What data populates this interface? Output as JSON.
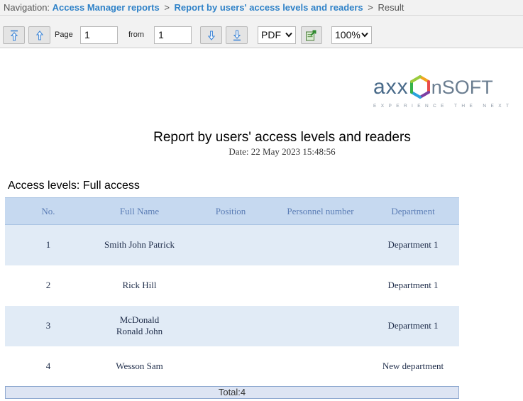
{
  "navigation": {
    "prefix": "Navigation:",
    "crumbs": [
      "Access Manager reports",
      "Report by users' access levels and readers"
    ],
    "current": "Result",
    "separator": ">"
  },
  "toolbar": {
    "page_label": "Page",
    "page_value": "1",
    "from_label": "from",
    "from_value": "1",
    "format": "PDF",
    "zoom": "100%"
  },
  "logo": {
    "word_left": "axx",
    "word_right": "nSOFT",
    "tagline": "EXPERIENCE THE NEXT",
    "colors": [
      "#f2a51f",
      "#e84a4a",
      "#7c3fa3",
      "#2aa3dc",
      "#35b24a"
    ]
  },
  "report": {
    "title": "Report by users' access levels and readers",
    "date": "Date: 22 May 2023 15:48:56",
    "section": "Access levels: Full access",
    "columns": [
      "No.",
      "Full Name",
      "Position",
      "Personnel number",
      "Department"
    ],
    "rows": [
      {
        "no": "1",
        "name": "Smith John Patrick",
        "position": "",
        "personnel": "",
        "department": "Department 1"
      },
      {
        "no": "2",
        "name": "Rick Hill",
        "position": "",
        "personnel": "",
        "department": "Department 1"
      },
      {
        "no": "3",
        "name": "McDonald Ronald John",
        "position": "",
        "personnel": "",
        "department": "Department 1"
      },
      {
        "no": "4",
        "name": "Wesson Sam",
        "position": "",
        "personnel": "",
        "department": "New department"
      }
    ],
    "total": "Total:4"
  }
}
